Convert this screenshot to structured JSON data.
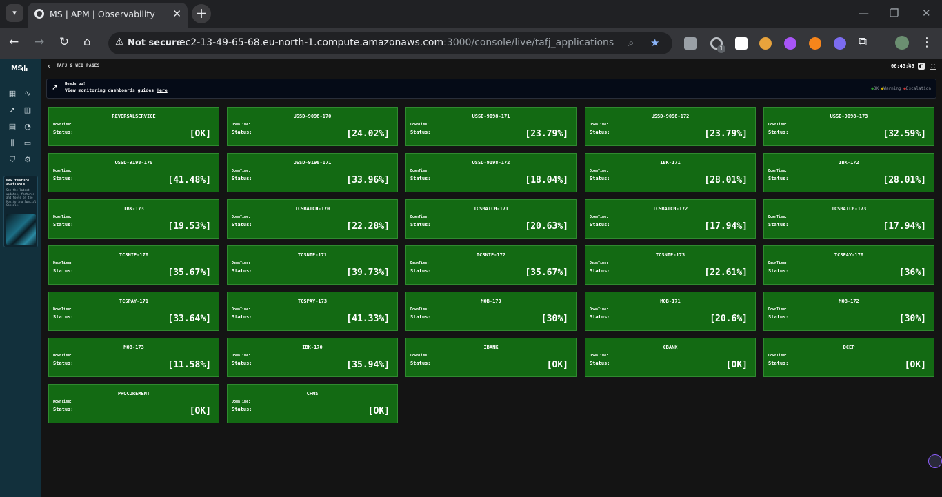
{
  "browser": {
    "tab_title": "MS | APM | Observability",
    "not_secure_label": "Not secure",
    "url_host": "ec2-13-49-65-68.eu-north-1.compute.amazonaws.com",
    "url_path": ":3000/console/live/tafj_applications",
    "extension_badge": "1"
  },
  "app": {
    "logo": "MS",
    "promo": {
      "title": "New feature available!",
      "text": "See the latest updates, features and tools on the Monitoring Spatial Console."
    }
  },
  "header": {
    "back_icon": "chevron-left-icon",
    "title": "TAFJ & WEB PAGES",
    "time": "06:43:46"
  },
  "banner": {
    "heading": "Heads up!",
    "text": "View monitoring dashboards guides ",
    "link_text": "Here",
    "legend": [
      {
        "label": "OK",
        "color": "#2f9a2f"
      },
      {
        "label": "Warning",
        "color": "#d4b200"
      },
      {
        "label": "Escalation",
        "color": "#cc3333"
      }
    ]
  },
  "cards": {
    "downtime_label": "DownTime:",
    "status_label": "Status:",
    "items": [
      {
        "name": "REVERSALSERVICE",
        "status": "[OK]"
      },
      {
        "name": "USSD-9098-170",
        "status": "[24.02%]"
      },
      {
        "name": "USSD-9098-171",
        "status": "[23.79%]"
      },
      {
        "name": "USSD-9098-172",
        "status": "[23.79%]"
      },
      {
        "name": "USSD-9098-173",
        "status": "[32.59%]"
      },
      {
        "name": "USSD-9198-170",
        "status": "[41.48%]"
      },
      {
        "name": "USSD-9198-171",
        "status": "[33.96%]"
      },
      {
        "name": "USSD-9198-172",
        "status": "[18.04%]"
      },
      {
        "name": "IBK-171",
        "status": "[28.01%]"
      },
      {
        "name": "IBK-172",
        "status": "[28.01%]"
      },
      {
        "name": "IBK-173",
        "status": "[19.53%]"
      },
      {
        "name": "TCSBATCH-170",
        "status": "[22.28%]"
      },
      {
        "name": "TCSBATCH-171",
        "status": "[20.63%]"
      },
      {
        "name": "TCSBATCH-172",
        "status": "[17.94%]"
      },
      {
        "name": "TCSBATCH-173",
        "status": "[17.94%]"
      },
      {
        "name": "TCSNIP-170",
        "status": "[35.67%]"
      },
      {
        "name": "TCSNIP-171",
        "status": "[39.73%]"
      },
      {
        "name": "TCSNIP-172",
        "status": "[35.67%]"
      },
      {
        "name": "TCSNIP-173",
        "status": "[22.61%]"
      },
      {
        "name": "TCSPAY-170",
        "status": "[36%]"
      },
      {
        "name": "TCSPAY-171",
        "status": "[33.64%]"
      },
      {
        "name": "TCSPAY-173",
        "status": "[41.33%]"
      },
      {
        "name": "MOB-170",
        "status": "[30%]"
      },
      {
        "name": "MOB-171",
        "status": "[20.6%]"
      },
      {
        "name": "MOB-172",
        "status": "[30%]"
      },
      {
        "name": "MOB-173",
        "status": "[11.58%]"
      },
      {
        "name": "IBK-170",
        "status": "[35.94%]"
      },
      {
        "name": "IBANK",
        "status": "[OK]"
      },
      {
        "name": "CBANK",
        "status": "[OK]"
      },
      {
        "name": "DCEP",
        "status": "[OK]"
      },
      {
        "name": "PROCUREMENT",
        "status": "[OK]"
      },
      {
        "name": "CFMS",
        "status": "[OK]"
      }
    ]
  }
}
